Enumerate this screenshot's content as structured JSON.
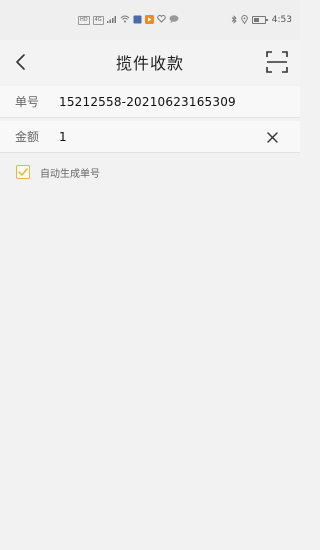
{
  "status_bar": {
    "left_badges": [
      "HD",
      "4G"
    ],
    "time": "4:53"
  },
  "nav": {
    "title": "揽件收款"
  },
  "form": {
    "order_label": "单号",
    "order_value": "15212558-20210623165309",
    "amount_label": "金额",
    "amount_value": "1"
  },
  "options": {
    "auto_generate_label": "自动生成单号",
    "auto_generate_checked": true
  },
  "colors": {
    "checkbox_accent": "#e0b845"
  }
}
